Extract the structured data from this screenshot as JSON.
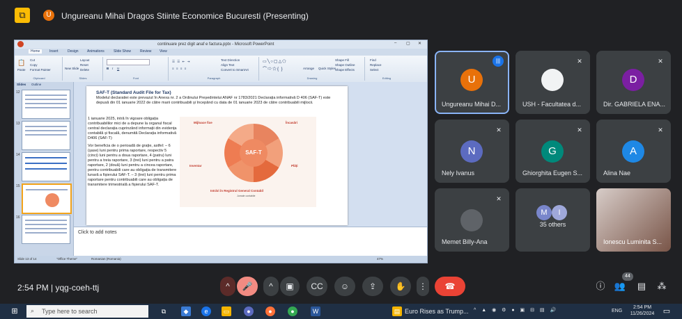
{
  "meeting": {
    "presenter_initial": "U",
    "presenting_title": "Ungureanu Mihai Dragos Stiinte Economice Bucuresti (Presenting)",
    "time": "2:54 PM",
    "code": "yqg-coeh-ttj",
    "participant_count": "44"
  },
  "ppt": {
    "window_title": "continuare prez digit anaf e factura.pptx - Microsoft PowerPoint",
    "tabs": [
      "Home",
      "Insert",
      "Design",
      "Animations",
      "Slide Show",
      "Review",
      "View"
    ],
    "ribbon": {
      "clipboard": {
        "label": "Clipboard",
        "paste": "Paste",
        "cut": "Cut",
        "copy": "Copy",
        "format_painter": "Format Painter"
      },
      "slides": {
        "label": "Slides",
        "new_slide": "New Slide",
        "layout": "Layout",
        "reset": "Reset",
        "delete": "Delete"
      },
      "font": {
        "label": "Font"
      },
      "paragraph": {
        "label": "Paragraph",
        "text_direction": "Text Direction",
        "align_text": "Align Text",
        "smartart": "Convert to SmartArt"
      },
      "drawing": {
        "label": "Drawing",
        "arrange": "Arrange",
        "quick_styles": "Quick Styles",
        "shape_fill": "Shape Fill",
        "shape_outline": "Shape Outline",
        "shape_effects": "Shape Effects"
      },
      "editing": {
        "label": "Editing",
        "find": "Find",
        "replace": "Replace",
        "select": "Select"
      }
    },
    "pane_tabs": [
      "Slides",
      "Outline"
    ],
    "thumb_numbers": [
      "12",
      "13",
      "14",
      "15",
      "16"
    ],
    "notes_placeholder": "Click to add notes",
    "status": {
      "slide": "Slide 13 of 14",
      "theme": "\"Office Theme\"",
      "language": "Romanian (Romania)",
      "zoom": "47%"
    }
  },
  "slide": {
    "heading": "SAF-T (Standard Audit File for Tax)",
    "intro": "Modelul declaratiei este prevazut în Anexa nr. 2 a Ordinului Președintelui ANAF nr 1783/2021 Declarația informativă D 406 (SAF-T) este depusă din 01 ianuarie 2022 de către marii contribuabili și începând cu data de 01 ianuarie 2023 de către contribuabili mijlocii.",
    "para1": "1 ianuarie 2025, intră în vigoare obligația contribuabililor mici de a depune la organul fiscal central declarația cuprinzând informații din evidența contabilă și fiscală, denumită Declarația informativă D406 (SAF-T)",
    "para2": "Vor beneficia de o perioadă de grație, astfel: – 6 (șase) luni pentru prima raportare, respectiv 5 (cinci) luni pentru a doua raportare, 4 (patru) luni pentru a treia raportare, 3 (trei) luni pentru a patra raportare, 2 (două) luni pentru a cincea raportare, pentru contribuabili care au obligația de transmitere lunară a fișierului SAF-T. – 3 (trei) luni pentru prima raportare pentru contribuabili care au obligația de transmitere trimestrială a fișierului SAF-T.",
    "diagram": {
      "center": "SAF-T",
      "top_left": "Mijloace fixe",
      "top_right": "Încasări",
      "left": "Inventar",
      "right": "Plăți",
      "bottom": "Intrări în Registrul General Contabil",
      "bottom_sub": "Jurnale contabile"
    }
  },
  "tiles": [
    {
      "initial": "U",
      "name": "Ungureanu Mihai D...",
      "color": "#e8710a",
      "speaking": true
    },
    {
      "initial": "",
      "name": "USH - Facultatea d...",
      "color": "#f1f3f4",
      "photo": true
    },
    {
      "initial": "D",
      "name": "Dir. GABRIELA ENA...",
      "color": "#7b1fa2"
    },
    {
      "initial": "N",
      "name": "Nely Ivanus",
      "color": "#5c6bc0"
    },
    {
      "initial": "G",
      "name": "Ghiorghita Eugen S...",
      "color": "#00897b"
    },
    {
      "initial": "A",
      "name": "Alina Nae",
      "color": "#1e88e5"
    },
    {
      "initial": "",
      "name": "Memet Billy-Ana",
      "color": "#5f6368",
      "photo": true
    },
    {
      "initial": "",
      "name": "35 others",
      "color": "#3c4043"
    },
    {
      "initial": "",
      "name": "Ionescu Luminita S...",
      "color": "#8d6e63",
      "photo": true
    }
  ],
  "others": {
    "a": "M",
    "b": "I"
  },
  "taskbar": {
    "search": "Type here to search",
    "news": "Euro Rises as Trump...",
    "lang": "ENG",
    "clock_time": "2:54 PM",
    "clock_date": "11/26/2024"
  }
}
